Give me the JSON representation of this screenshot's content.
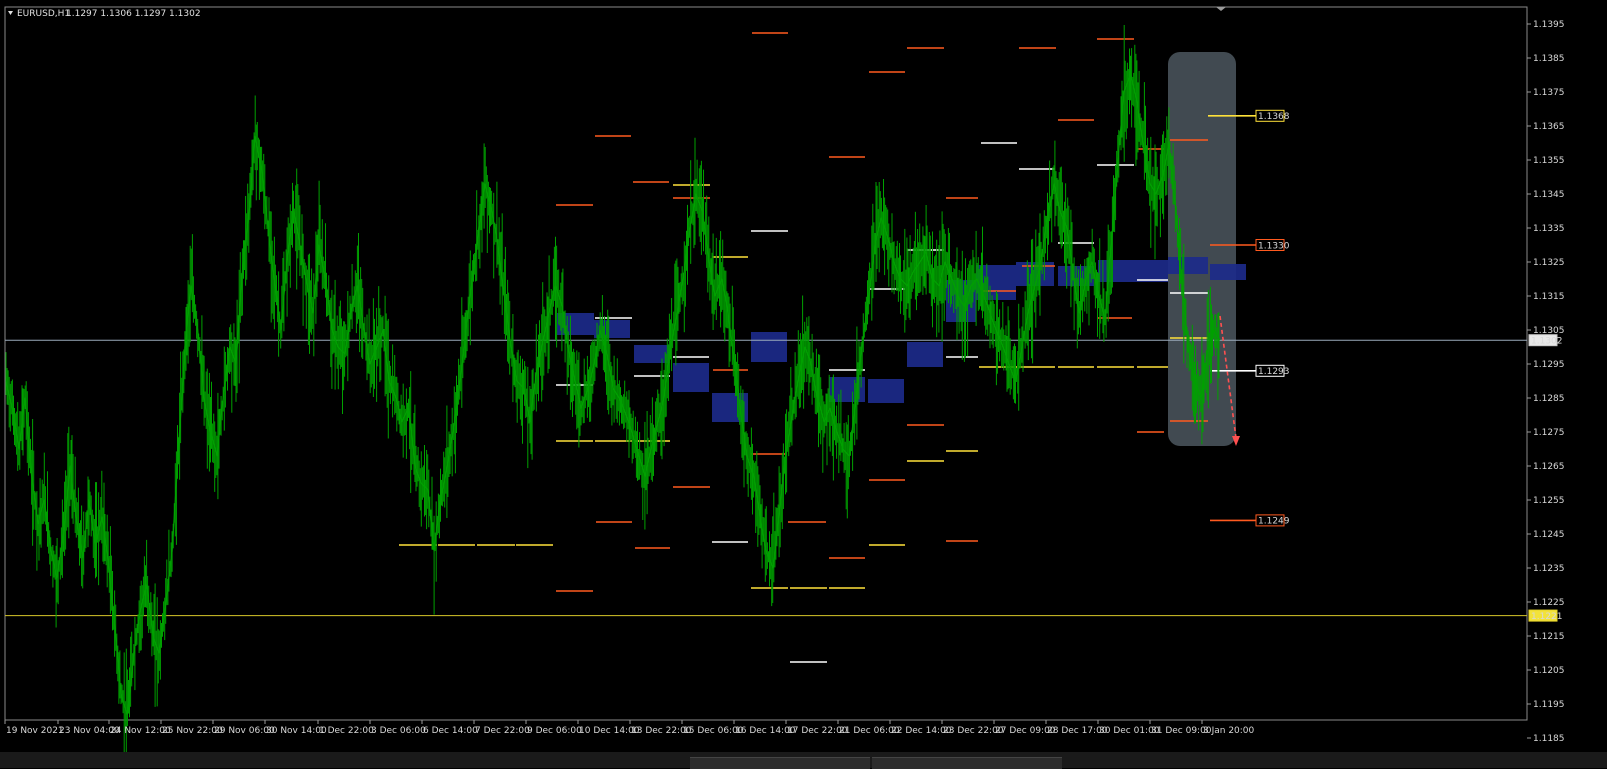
{
  "header": {
    "symbol": "EURUSD,H1",
    "ohlc": "1.1297 1.1306 1.1297 1.1302"
  },
  "y_axis": {
    "min": 1.118,
    "max": 1.14,
    "ticks": [
      "1.1395",
      "1.1385",
      "1.1375",
      "1.1365",
      "1.1355",
      "1.1345",
      "1.1335",
      "1.1325",
      "1.1315",
      "1.1305",
      "1.1295",
      "1.1285",
      "1.1275",
      "1.1265",
      "1.1255",
      "1.1245",
      "1.1235",
      "1.1225",
      "1.1215",
      "1.1205",
      "1.1195",
      "1.1185"
    ]
  },
  "x_axis": {
    "ticks": [
      "19 Nov 2021",
      "23 Nov 04:00",
      "24 Nov 12:00",
      "25 Nov 22:00",
      "29 Nov 06:00",
      "30 Nov 14:00",
      "1 Dec 22:00",
      "3 Dec 06:00",
      "6 Dec 14:00",
      "7 Dec 22:00",
      "9 Dec 06:00",
      "10 Dec 14:00",
      "13 Dec 22:00",
      "15 Dec 06:00",
      "16 Dec 14:00",
      "17 Dec 22:00",
      "21 Dec 06:00",
      "22 Dec 14:00",
      "23 Dec 22:00",
      "27 Dec 09:00",
      "28 Dec 17:00",
      "30 Dec 01:00",
      "31 Dec 09:00",
      "3 Jan 20:00"
    ]
  },
  "price_labels": {
    "current": "1.1302",
    "yellow_line": "1.1221",
    "level_yellow": "1.1368",
    "level_red_upper": "1.1330",
    "level_white": "1.1293",
    "level_red_lower": "1.1249"
  },
  "colors": {
    "background": "#000000",
    "candles": "#00a000",
    "resistance": "#ff5a1f",
    "support_white": "#ffffff",
    "support_yellow": "#ffe23a",
    "zone": "#1c2a8a",
    "highlight": "#5a6670",
    "arrow": "#ff5050"
  },
  "chart_data": {
    "type": "line",
    "series": [
      {
        "values": [
          1.129,
          1.1282,
          1.127,
          1.1285,
          1.1262,
          1.1248,
          1.1255,
          1.124,
          1.1232,
          1.1245,
          1.1265,
          1.125,
          1.1238,
          1.1255,
          1.1242,
          1.125,
          1.1238,
          1.1218,
          1.1198,
          1.1192,
          1.121,
          1.1222,
          1.123,
          1.1215,
          1.121,
          1.1225,
          1.124,
          1.127,
          1.13,
          1.1318,
          1.1305,
          1.1285,
          1.1275,
          1.1268,
          1.1285,
          1.13,
          1.1295,
          1.1322,
          1.134,
          1.1362,
          1.1352,
          1.1335,
          1.132,
          1.1305,
          1.1325,
          1.134,
          1.133,
          1.132,
          1.131,
          1.133,
          1.132,
          1.1305,
          1.13,
          1.1298,
          1.131,
          1.1318,
          1.1305,
          1.1295,
          1.13,
          1.1305,
          1.129,
          1.1285,
          1.1278,
          1.1282,
          1.1265,
          1.126,
          1.1258,
          1.124,
          1.1255,
          1.1265,
          1.1275,
          1.129,
          1.1305,
          1.132,
          1.1335,
          1.1348,
          1.134,
          1.133,
          1.1315,
          1.13,
          1.129,
          1.1288,
          1.1278,
          1.1292,
          1.1302,
          1.131,
          1.1318,
          1.1312,
          1.13,
          1.129,
          1.1282,
          1.1287,
          1.1295,
          1.1305,
          1.1298,
          1.1288,
          1.1285,
          1.128,
          1.1275,
          1.1268,
          1.1262,
          1.127,
          1.1278,
          1.1285,
          1.13,
          1.131,
          1.132,
          1.1335,
          1.1345,
          1.134,
          1.1325,
          1.1315,
          1.132,
          1.131,
          1.1296,
          1.128,
          1.1268,
          1.1262,
          1.125,
          1.124,
          1.1235,
          1.125,
          1.1268,
          1.128,
          1.129,
          1.13,
          1.1295,
          1.1285,
          1.1278,
          1.1282,
          1.1275,
          1.127,
          1.1268,
          1.1285,
          1.13,
          1.1315,
          1.133,
          1.1338,
          1.1332,
          1.1325,
          1.132,
          1.1318,
          1.1322,
          1.1325,
          1.1328,
          1.132,
          1.1318,
          1.1325,
          1.132,
          1.1315,
          1.1312,
          1.1318,
          1.132,
          1.1315,
          1.131,
          1.1305,
          1.13,
          1.1295,
          1.129,
          1.13,
          1.131,
          1.1318,
          1.1325,
          1.1338,
          1.1348,
          1.134,
          1.1335,
          1.1322,
          1.131,
          1.132,
          1.1325,
          1.1315,
          1.1308,
          1.133,
          1.1355,
          1.1375,
          1.138,
          1.1372,
          1.136,
          1.1348,
          1.1345,
          1.135,
          1.136,
          1.1342,
          1.132,
          1.13,
          1.129,
          1.1285,
          1.1298,
          1.1305,
          1.1302
        ],
        "color": "#00a000"
      }
    ],
    "ylim": [
      1.118,
      1.14
    ],
    "levels": [
      {
        "value": 1.1221,
        "label": "1.1221",
        "color": "#ffe23a"
      },
      {
        "value": 1.1302,
        "label": "1.1302",
        "color": "#b0b0b0"
      }
    ],
    "xlabel": "",
    "ylabel": "",
    "title": ""
  }
}
